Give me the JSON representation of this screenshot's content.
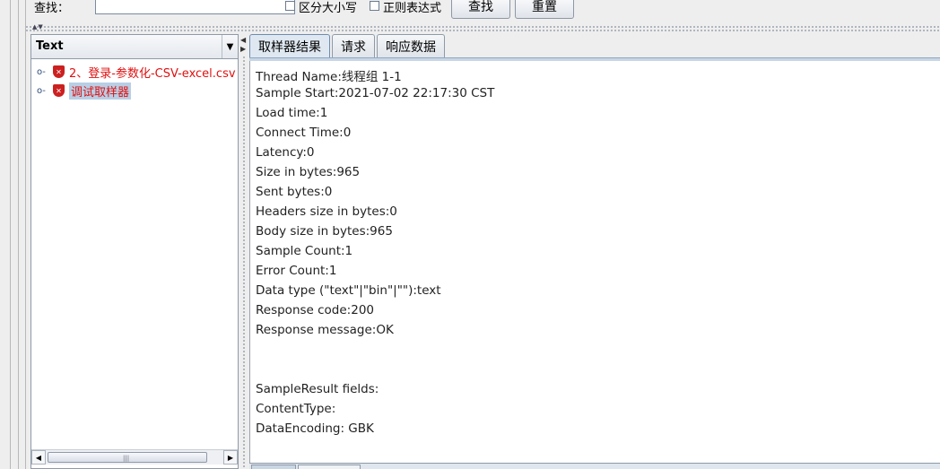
{
  "search": {
    "label": "查找：",
    "value": "",
    "case_label": "区分大小写",
    "regex_label": "正则表达式",
    "find_button": "查找",
    "reset_button": "重置"
  },
  "renderer": {
    "selected": "Text"
  },
  "tree": {
    "items": [
      {
        "label": "2、登录-参数化-CSV-excel.csv",
        "icon": "error-shield-icon"
      },
      {
        "label": "调试取样器",
        "icon": "error-shield-icon",
        "selected": true
      }
    ]
  },
  "tabs": [
    {
      "label": "取样器结果",
      "active": true
    },
    {
      "label": "请求",
      "active": false
    },
    {
      "label": "响应数据",
      "active": false
    }
  ],
  "result": {
    "lines": [
      "Thread Name:线程组 1-1",
      "Sample Start:2021-07-02 22:17:30 CST",
      "Load time:1",
      "Connect Time:0",
      "Latency:0",
      "Size in bytes:965",
      "Sent bytes:0",
      "Headers size in bytes:0",
      "Body size in bytes:965",
      "Sample Count:1",
      "Error Count:1",
      "Data type (\"text\"|\"bin\"|\"\"):text",
      "Response code:200",
      "Response message:OK",
      "",
      "",
      "SampleResult fields:",
      "ContentType:",
      "DataEncoding: GBK"
    ]
  },
  "colors": {
    "error_text": "#e01010",
    "selection": "#b8cfe5",
    "shield": "#cc2020"
  }
}
